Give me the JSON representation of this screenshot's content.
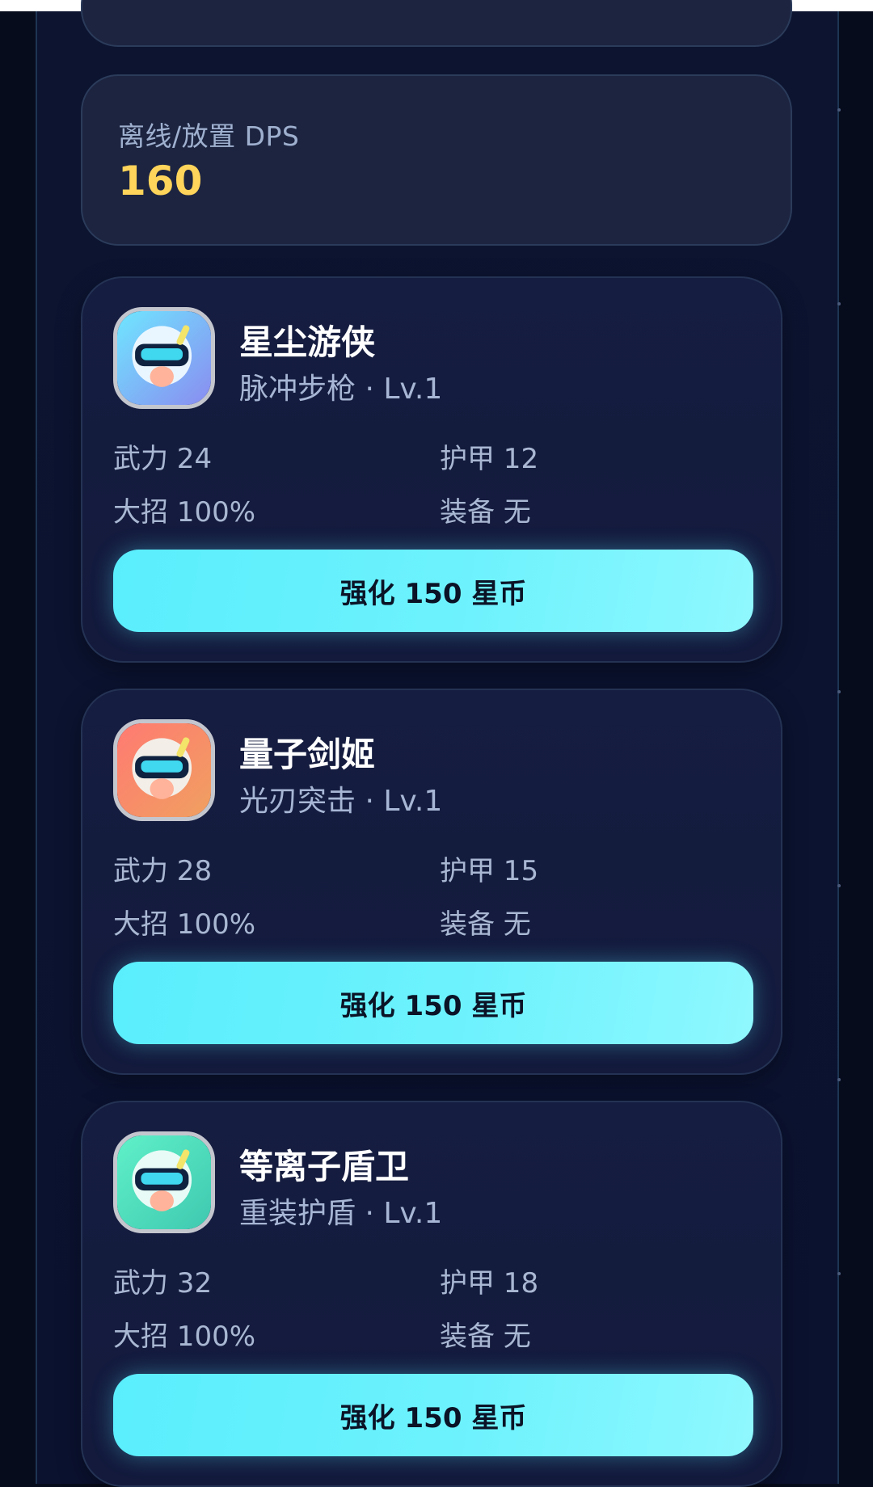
{
  "dps": {
    "label": "离线/放置 DPS",
    "value": "160",
    "value_color": "#ffd45a"
  },
  "heroes": [
    {
      "name": "星尘游侠",
      "subtitle": "脉冲步枪 · Lv.1",
      "power": "武力 24",
      "armor": "护甲 12",
      "ultimate": "大招 100%",
      "equipment": "装备 无",
      "upgrade_label": "强化 150 星币",
      "avatar_colors": [
        "#6fe6ff",
        "#8a8cf0"
      ],
      "avatar_icon": "robot-head-icon"
    },
    {
      "name": "量子剑姬",
      "subtitle": "光刃突击 · Lv.1",
      "power": "武力 28",
      "armor": "护甲 15",
      "ultimate": "大招 100%",
      "equipment": "装备 无",
      "upgrade_label": "强化 150 星币",
      "avatar_colors": [
        "#ff7a72",
        "#f0a060"
      ],
      "avatar_icon": "robot-head-icon"
    },
    {
      "name": "等离子盾卫",
      "subtitle": "重装护盾 · Lv.1",
      "power": "武力 32",
      "armor": "护甲 18",
      "ultimate": "大招 100%",
      "equipment": "装备 无",
      "upgrade_label": "强化 150 星币",
      "avatar_colors": [
        "#5ff0c8",
        "#3fc9b0"
      ],
      "avatar_icon": "robot-head-icon"
    }
  ],
  "colors": {
    "background": "#070c1c",
    "card": "#151d40",
    "accent": "#5aeefd"
  }
}
